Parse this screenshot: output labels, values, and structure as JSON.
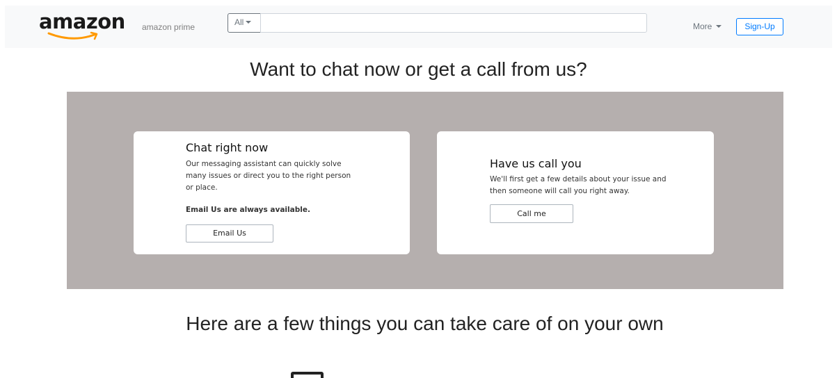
{
  "navbar": {
    "logo_text": "amazon",
    "prime_link": "amazon prime",
    "search": {
      "category": "All",
      "placeholder": "",
      "value": ""
    },
    "more_label": "More",
    "signup_label": "Sign-Up",
    "colors": {
      "accent": "#007bff",
      "logo_smile": "#f90"
    }
  },
  "contact": {
    "heading": "Want to chat now or get a call from us?",
    "chat_card": {
      "title": "Chat right now",
      "description": "Our messaging assistant can quickly solve many issues or direct you to the right person or place.",
      "note": "Email Us are always available.",
      "button_label": "Email Us"
    },
    "call_card": {
      "title": "Have us call you",
      "description": "We'll first get a few details about your issue and then someone will call you right away.",
      "button_label": "Call me"
    },
    "band_color": "#b5afae"
  },
  "self_service": {
    "heading": "Here are a few things you can take care of on your own",
    "icon": "box-icon"
  }
}
